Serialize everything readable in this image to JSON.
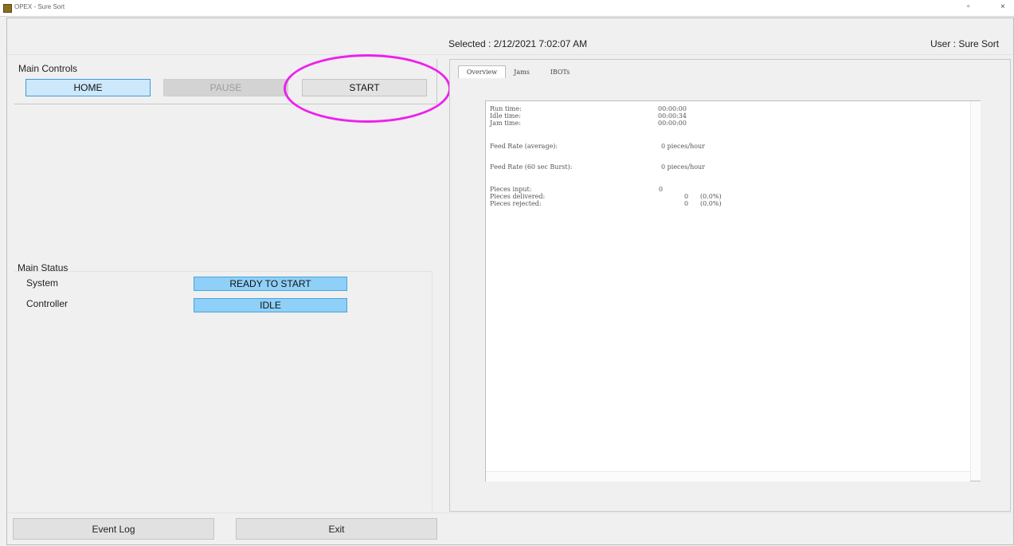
{
  "window": {
    "title": "OPEX - Sure Sort",
    "restore_glyph": "▫",
    "close_glyph": "×"
  },
  "header": {
    "selected": "Selected : 2/12/2021 7:02:07 AM",
    "user": "User : Sure Sort"
  },
  "main_controls": {
    "label": "Main Controls",
    "home": "HOME",
    "pause": "PAUSE",
    "start": "START"
  },
  "main_status": {
    "label": "Main Status",
    "system_label": "System",
    "system_value": "READY TO START",
    "controller_label": "Controller",
    "controller_value": "IDLE"
  },
  "tabs": [
    {
      "label": "Overview",
      "active": true
    },
    {
      "label": "Jams",
      "active": false
    },
    {
      "label": "IBOTs",
      "active": false
    }
  ],
  "stats": [
    {
      "label": "Run time:",
      "value": "00:00:00"
    },
    {
      "label": "Idle time:",
      "value": "00:00:34"
    },
    {
      "label": "Jam time:",
      "value": "00:00:00"
    },
    {
      "label": "Feed Rate (average):",
      "value": "0 pieces/hour"
    },
    {
      "label": "Feed Rate (60 sec Burst):",
      "value": "0 pieces/hour"
    },
    {
      "label": "Pieces input:",
      "value": "0"
    },
    {
      "label": "Pieces delivered:",
      "value": "0",
      "percent": "(0.0%)"
    },
    {
      "label": "Pieces rejected:",
      "value": "0",
      "percent": "(0.0%)"
    }
  ],
  "footer": {
    "event_log": "Event Log",
    "exit": "Exit"
  },
  "colors": {
    "highlight_ring": "#ee20ee",
    "status_badge": "#8fd0f8",
    "home_button": "#cde8fb"
  }
}
